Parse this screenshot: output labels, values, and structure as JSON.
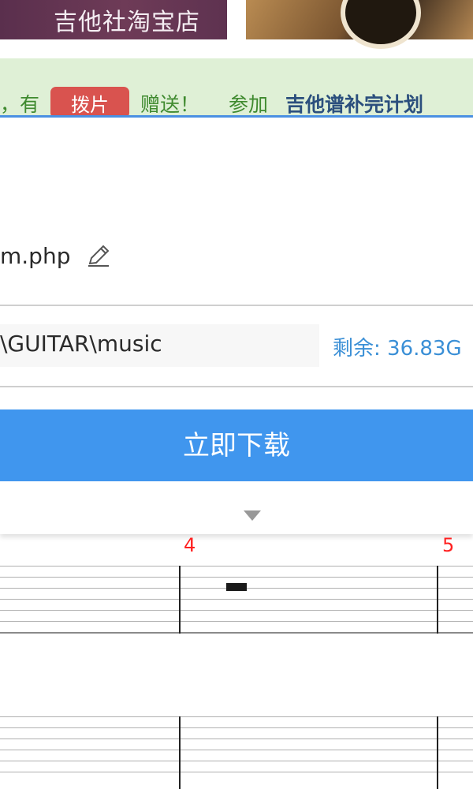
{
  "banner": {
    "shop_label": "吉他社淘宝店"
  },
  "notice": {
    "prefix": "，有",
    "tag_label": "拨片",
    "gift": "赠送！",
    "join": "参加",
    "link": "吉他谱补完计划"
  },
  "panel": {
    "filename": "m.php",
    "path": "\\GUITAR\\music",
    "free_space": "剩余: 36.83G",
    "download_label": "立即下载"
  },
  "tab": {
    "measure_numbers": [
      "4",
      "5"
    ]
  },
  "colors": {
    "accent": "#4096ee",
    "notice_bg": "#dff0d6",
    "tag_red": "#d9534f",
    "measure_red": "#ff2020"
  }
}
